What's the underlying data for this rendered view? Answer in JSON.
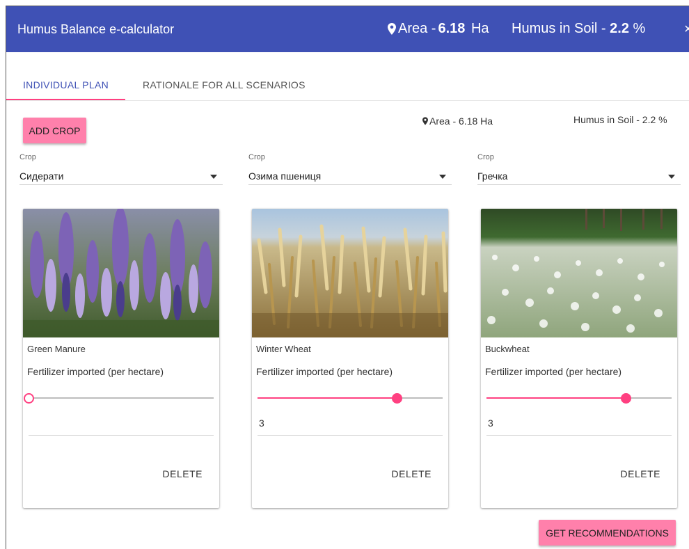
{
  "app": {
    "title": "Humus Balance e-calculator",
    "area_label": "Area - ",
    "area_value": "6.18",
    "area_unit": " Ha",
    "humus_label": "Humus in Soil - ",
    "humus_value": "2.2",
    "humus_unit": " %",
    "close_symbol": "×"
  },
  "tabs": [
    {
      "label": "INDIVIDUAL PLAN",
      "active": true
    },
    {
      "label": "RATIONALE FOR ALL SCENARIOS",
      "active": false
    }
  ],
  "toolbar": {
    "add_crop_label": "ADD CROP",
    "area_info": "Area - 6.18 Ha",
    "humus_info": "Humus in Soil - 2.2 %"
  },
  "crops": [
    {
      "select_label": "Crop",
      "select_value": "Сидерати",
      "name": "Green Manure",
      "fertilizer_label": "Fertilizer imported (per hectare)",
      "slider_fraction": 0.0,
      "amount": "",
      "delete_label": "DELETE",
      "image_icon": "lupine-flowers-image"
    },
    {
      "select_label": "Crop",
      "select_value": "Озима пшениця",
      "name": "Winter Wheat",
      "fertilizer_label": "Fertilizer imported (per hectare)",
      "slider_fraction": 0.75,
      "amount": "3",
      "delete_label": "DELETE",
      "image_icon": "wheat-field-image"
    },
    {
      "select_label": "Crop",
      "select_value": "Гречка",
      "name": "Buckwheat",
      "fertilizer_label": "Fertilizer imported (per hectare)",
      "slider_fraction": 0.75,
      "amount": "3",
      "delete_label": "DELETE",
      "image_icon": "buckwheat-field-image"
    }
  ],
  "footer": {
    "get_recommendations_label": "GET RECOMMENDATIONS"
  },
  "colors": {
    "appbar": "#3f51b5",
    "accent": "#ff4081",
    "button": "#ff80ab"
  }
}
